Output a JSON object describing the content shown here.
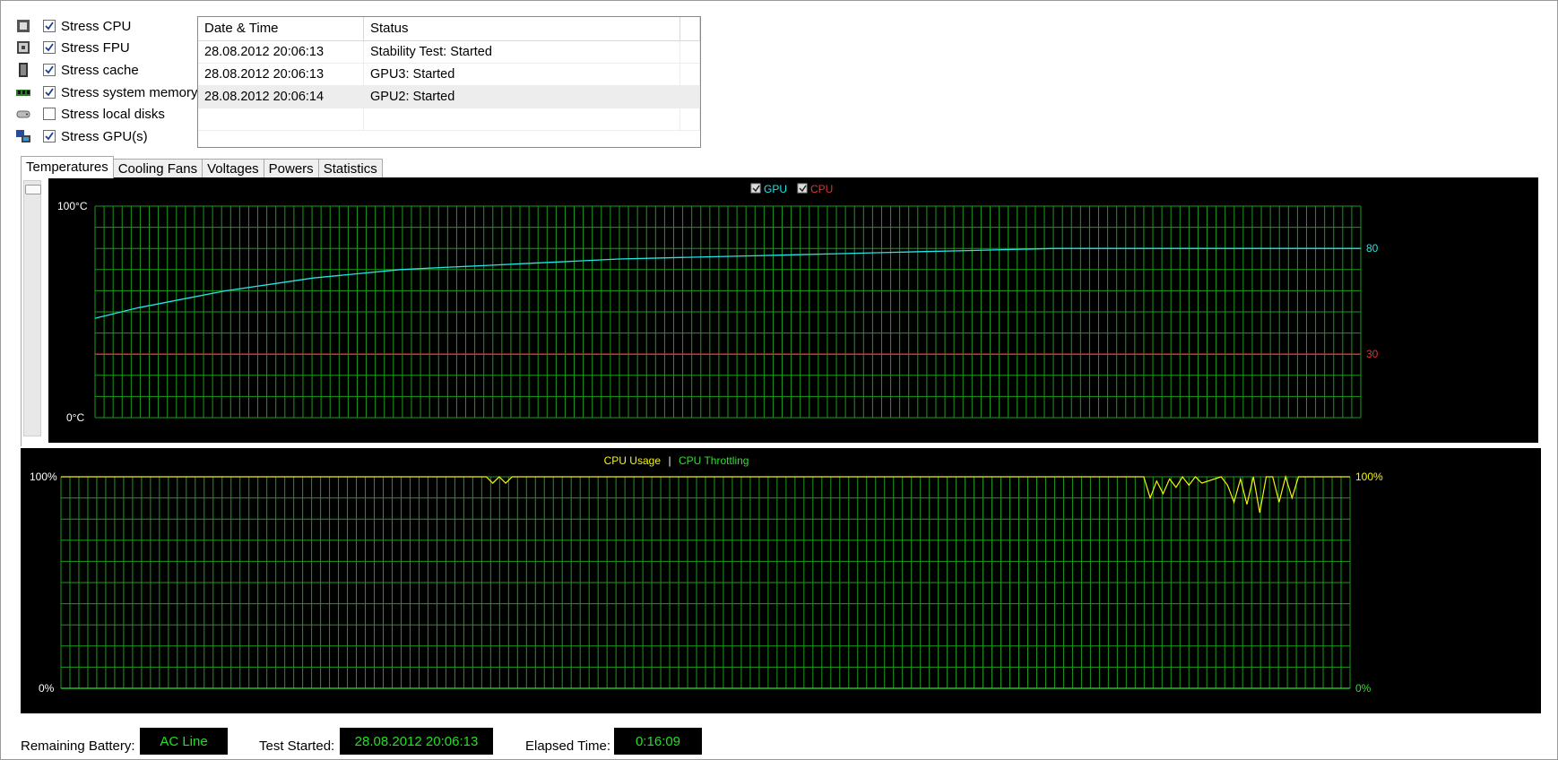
{
  "stress_options": [
    {
      "label": "Stress CPU",
      "checked": true,
      "icon": "cpu-icon"
    },
    {
      "label": "Stress FPU",
      "checked": true,
      "icon": "fpu-icon"
    },
    {
      "label": "Stress cache",
      "checked": true,
      "icon": "cache-icon"
    },
    {
      "label": "Stress system memory",
      "checked": true,
      "icon": "memory-icon"
    },
    {
      "label": "Stress local disks",
      "checked": false,
      "icon": "disk-icon"
    },
    {
      "label": "Stress GPU(s)",
      "checked": true,
      "icon": "gpu-icon"
    }
  ],
  "log": {
    "columns": [
      "Date & Time",
      "Status"
    ],
    "rows": [
      {
        "datetime": "28.08.2012 20:06:13",
        "status": "Stability Test: Started"
      },
      {
        "datetime": "28.08.2012 20:06:13",
        "status": "GPU3: Started"
      },
      {
        "datetime": "28.08.2012 20:06:14",
        "status": "GPU2: Started"
      }
    ]
  },
  "tabs": [
    "Temperatures",
    "Cooling Fans",
    "Voltages",
    "Powers",
    "Statistics"
  ],
  "active_tab": "Temperatures",
  "colors": {
    "gpu": "#22e5e5",
    "cpu": "#e03434",
    "usage": "#f4f40c",
    "throttle": "#2ee02e",
    "grid": "#1b9a1b"
  },
  "chart_data": [
    {
      "type": "line",
      "legend": [
        {
          "name": "GPU",
          "checked": true
        },
        {
          "name": "CPU",
          "checked": true
        }
      ],
      "ylim": [
        0,
        100
      ],
      "y_top_label": "100°C",
      "y_bottom_label": "0°C",
      "series": [
        {
          "name": "GPU",
          "values": [
            47,
            52,
            56,
            60,
            63,
            66,
            68,
            70,
            71,
            72,
            73,
            74,
            75,
            75.5,
            76,
            76.5,
            77,
            77.5,
            78,
            78.5,
            79,
            79.5,
            80,
            80,
            80,
            80,
            80,
            80,
            80,
            80
          ],
          "end_label": "80"
        },
        {
          "name": "CPU",
          "values": [
            30,
            30,
            30,
            30,
            30,
            30,
            30,
            30,
            30,
            30,
            30,
            30,
            30,
            30,
            30,
            30,
            30,
            30,
            30,
            30,
            30,
            30,
            30,
            30,
            30,
            30,
            30,
            30,
            30,
            30
          ],
          "end_label": "30"
        }
      ]
    },
    {
      "type": "line",
      "title_left": "CPU Usage",
      "title_sep": "|",
      "title_right": "CPU Throttling",
      "ylim": [
        0,
        100
      ],
      "y_top_label": "100%",
      "y_bottom_label": "0%",
      "right_top_label": "100%",
      "right_bottom_label": "0%",
      "series": [
        {
          "name": "CPU Usage",
          "x": [
            0,
            0.33,
            0.335,
            0.34,
            0.345,
            0.35,
            0.84,
            0.845,
            0.85,
            0.855,
            0.86,
            0.865,
            0.87,
            0.875,
            0.88,
            0.885,
            0.9,
            0.905,
            0.91,
            0.915,
            0.92,
            0.925,
            0.93,
            0.935,
            0.94,
            0.945,
            0.95,
            0.955,
            0.96,
            1
          ],
          "values": [
            100,
            100,
            97,
            100,
            97,
            100,
            100,
            90,
            98,
            92,
            99,
            95,
            100,
            96,
            100,
            97,
            100,
            96,
            88,
            99,
            87,
            100,
            83,
            100,
            100,
            88,
            100,
            90,
            100,
            100
          ]
        },
        {
          "name": "CPU Throttling",
          "values": [
            0,
            0
          ]
        }
      ]
    }
  ],
  "status_bar": {
    "battery_label": "Remaining Battery:",
    "battery_value": "AC Line",
    "started_label": "Test Started:",
    "started_value": "28.08.2012 20:06:13",
    "elapsed_label": "Elapsed Time:",
    "elapsed_value": "0:16:09"
  }
}
